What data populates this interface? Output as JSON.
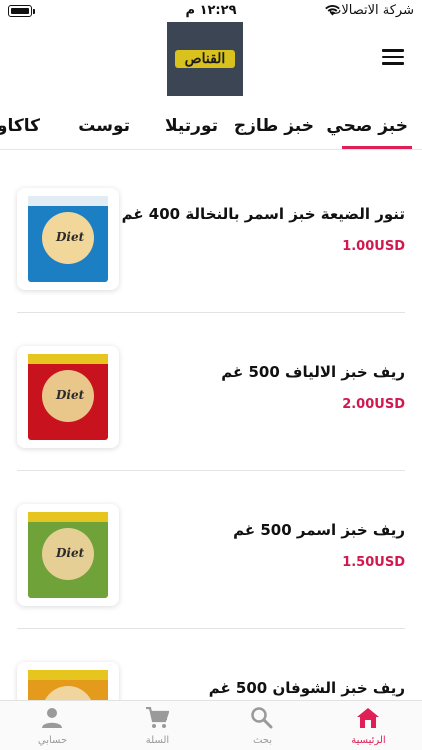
{
  "status_bar": {
    "time": "١٢:٢٩ م",
    "carrier": "شركة الاتصالات"
  },
  "header": {
    "logo_text": "القناص",
    "menu_icon": "hamburger-menu-icon"
  },
  "tabs": [
    {
      "label": "خبز صحي",
      "active": true
    },
    {
      "label": "خبز طازج",
      "active": false
    },
    {
      "label": "تورتيلا",
      "active": false
    },
    {
      "label": "توست",
      "active": false
    },
    {
      "label": "كاكاو",
      "active": false
    }
  ],
  "products": [
    {
      "name": "تنور الضيعة خبز اسمر بالنخالة 400 غم",
      "price": "1.00USD",
      "image_label": "Diet"
    },
    {
      "name": "ريف خبز الالياف 500 غم",
      "price": "2.00USD",
      "image_label": "Diet"
    },
    {
      "name": "ريف خبز اسمر 500 غم",
      "price": "1.50USD",
      "image_label": "Diet"
    },
    {
      "name": "ريف خبز الشوفان 500 غم",
      "price": "",
      "image_label": ""
    }
  ],
  "bottom_nav": [
    {
      "label": "حسابي",
      "icon": "account-icon",
      "active": false
    },
    {
      "label": "السلة",
      "icon": "cart-icon",
      "active": false
    },
    {
      "label": "بحث",
      "icon": "search-icon",
      "active": false
    },
    {
      "label": "الرئيسية",
      "icon": "home-icon",
      "active": true
    }
  ],
  "colors": {
    "accent": "#e01f56",
    "price": "#d1184f",
    "inactive_nav": "#9a9a9a"
  }
}
